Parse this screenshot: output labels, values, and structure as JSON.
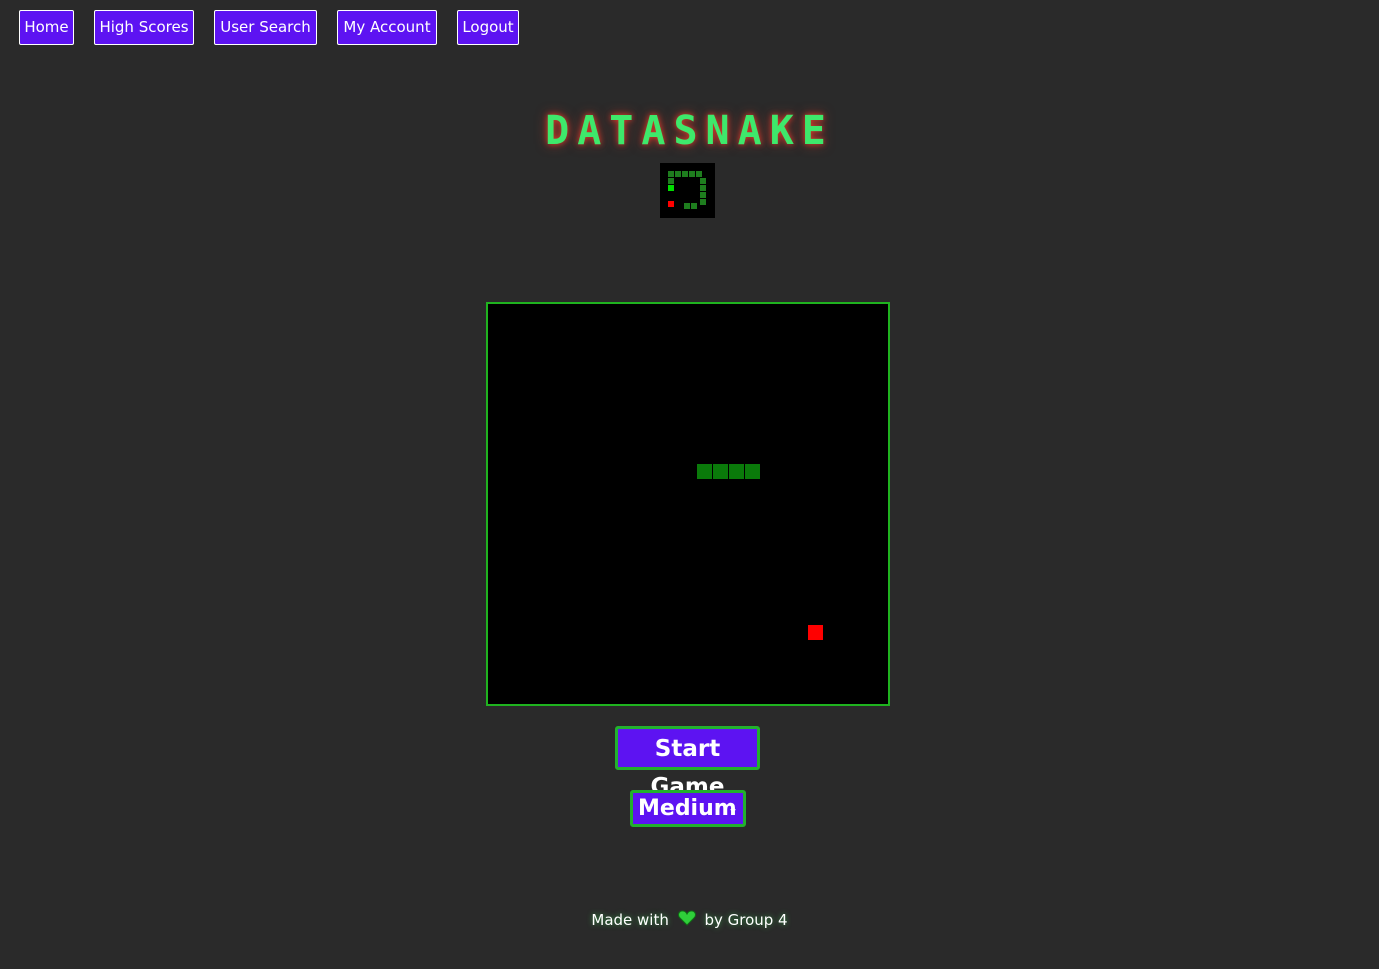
{
  "nav": {
    "items": [
      {
        "label": "Home"
      },
      {
        "label": "High Scores"
      },
      {
        "label": "User Search"
      },
      {
        "label": "My Account"
      },
      {
        "label": "Logout"
      }
    ]
  },
  "header": {
    "title": "DATASNAKE",
    "logo_icon": "snake-logo-icon"
  },
  "game": {
    "grid_size": 25,
    "snake_color": "#0a7a0a",
    "food_color": "#ff0000",
    "board_border_color": "#1fb31f",
    "snake_cells": [
      [
        13,
        10
      ],
      [
        14,
        10
      ],
      [
        15,
        10
      ],
      [
        16,
        10
      ]
    ],
    "food_cell": [
      20,
      20
    ]
  },
  "controls": {
    "start_label": "Start Game",
    "difficulty_value": "Medium"
  },
  "footer": {
    "prefix": "Made with",
    "heart_icon": "heart-icon",
    "suffix": "by Group 4"
  },
  "colors": {
    "accent": "#5d13f2",
    "title_green": "#3ee86b",
    "border_green": "#22b02e",
    "background": "#2a2a2a"
  }
}
